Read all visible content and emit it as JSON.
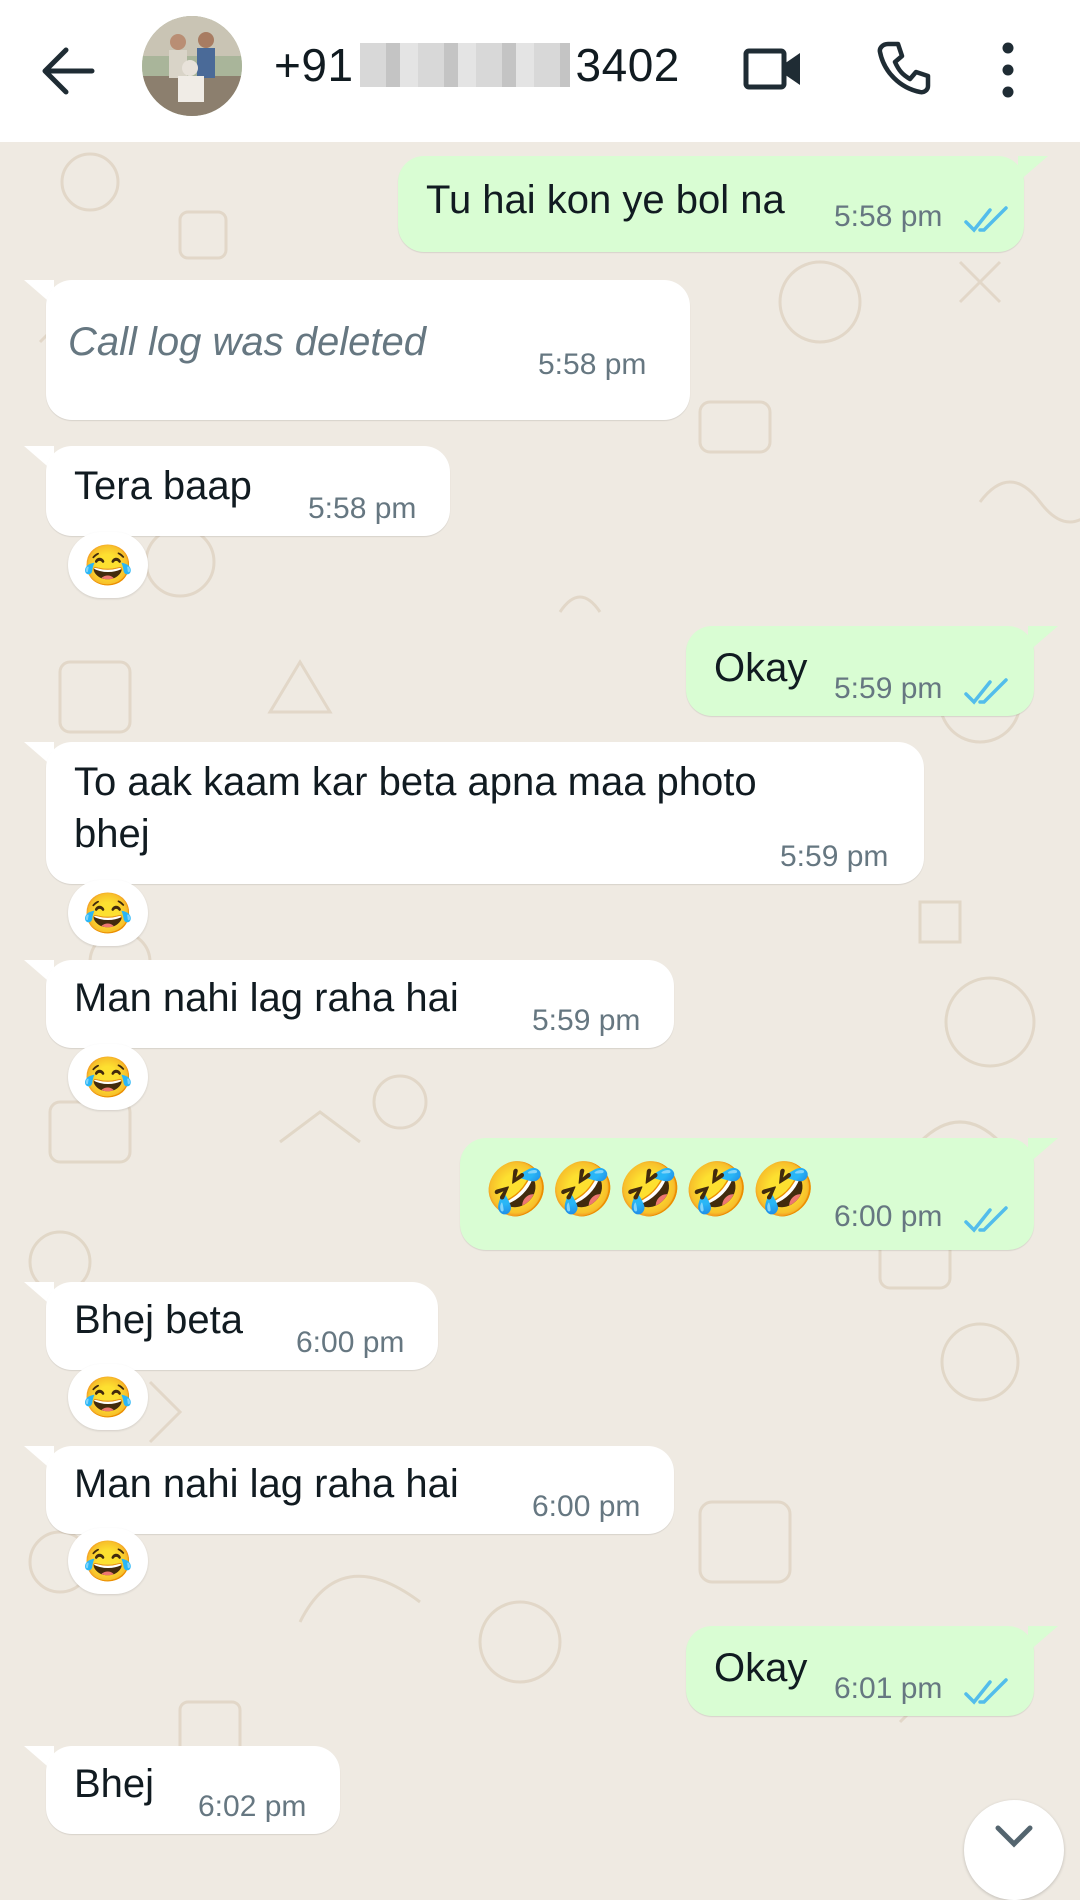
{
  "header": {
    "contact_prefix": "+91",
    "contact_suffix": "3402",
    "icons": [
      "back-arrow-icon",
      "avatar",
      "video-call-icon",
      "voice-call-icon",
      "more-options-icon"
    ]
  },
  "colors": {
    "incoming": "#ffffff",
    "outgoing": "#d9fdd3",
    "read_ticks": "#53bdeb",
    "wallpaper": "#efeae2"
  },
  "messages": [
    {
      "dir": "out",
      "text": "Tu hai kon ye bol na",
      "time": "5:58 pm"
    },
    {
      "dir": "in",
      "text": "Call log was deleted",
      "time": "5:58 pm"
    },
    {
      "dir": "in",
      "text": "Tera baap",
      "time": "5:58 pm",
      "reaction": "😂"
    },
    {
      "dir": "out",
      "text": "Okay",
      "time": "5:59 pm"
    },
    {
      "dir": "in",
      "text_line1": "To aak kaam kar beta apna maa photo",
      "text_line2": "bhej",
      "time": "5:59 pm",
      "reaction": "😂"
    },
    {
      "dir": "in",
      "text": "Man nahi lag raha hai",
      "time": "5:59 pm",
      "reaction": "😂"
    },
    {
      "dir": "out",
      "text": "🤣🤣🤣🤣🤣",
      "time": "6:00 pm"
    },
    {
      "dir": "in",
      "text": "Bhej beta",
      "time": "6:00 pm",
      "reaction": "😂"
    },
    {
      "dir": "in",
      "text": "Man nahi lag raha hai",
      "time": "6:00 pm",
      "reaction": "😂"
    },
    {
      "dir": "out",
      "text": "Okay",
      "time": "6:01 pm"
    },
    {
      "dir": "in",
      "text": "Bhej",
      "time": "6:02 pm"
    }
  ]
}
